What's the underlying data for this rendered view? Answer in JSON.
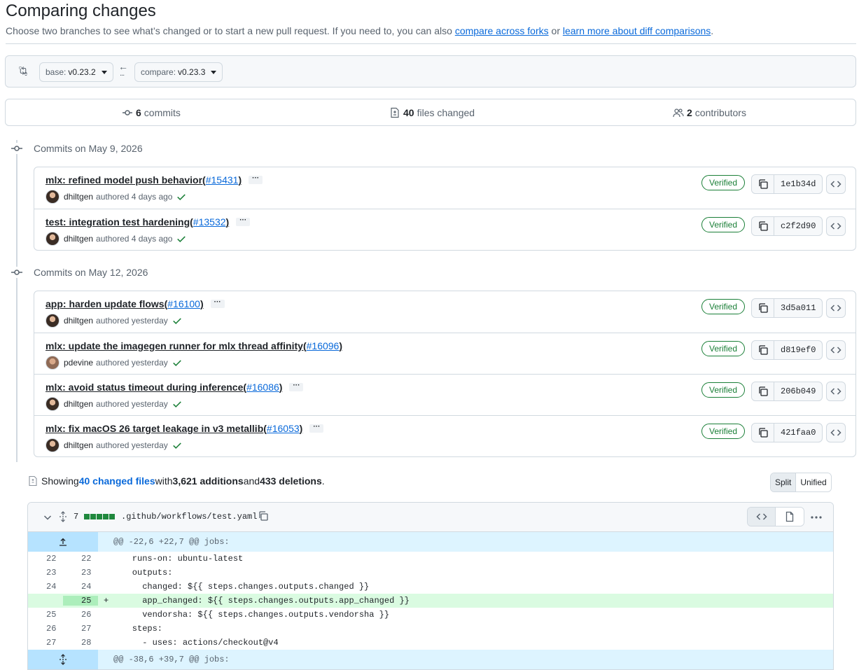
{
  "header": {
    "title": "Comparing changes",
    "desc_prefix": "Choose two branches to see what’s changed or to start a new pull request. If you need to, you can also ",
    "link_forks": "compare across forks",
    "desc_or": " or ",
    "link_learn": "learn more about diff comparisons",
    "desc_suffix": "."
  },
  "range": {
    "base_label": "base:",
    "base_value": "v0.23.2",
    "compare_label": "compare:",
    "compare_value": "v0.23.3"
  },
  "summary": {
    "commits_count": "6",
    "commits_label": "commits",
    "files_count": "40",
    "files_label": "files changed",
    "contributors_count": "2",
    "contributors_label": "contributors"
  },
  "commit_groups": [
    {
      "heading": "Commits on May 9, 2026",
      "commits": [
        {
          "msg": "mlx: refined model push behavior ",
          "pr": "#15431",
          "author": "dhiltgen",
          "when": "authored 4 days ago",
          "badge": "Verified",
          "sha": "1e1b34d"
        },
        {
          "msg": "test: integration test hardening ",
          "pr": "#13532",
          "author": "dhiltgen",
          "when": "authored 4 days ago",
          "badge": "Verified",
          "sha": "c2f2d90"
        }
      ]
    },
    {
      "heading": "Commits on May 12, 2026",
      "commits": [
        {
          "msg": "app: harden update flows ",
          "pr": "#16100",
          "author": "dhiltgen",
          "when": "authored yesterday",
          "badge": "Verified",
          "sha": "3d5a011"
        },
        {
          "msg": "mlx: update the imagegen runner for mlx thread affinity ",
          "pr": "#16096",
          "author": "pdevine",
          "when": "authored yesterday",
          "badge": "Verified",
          "sha": "d819ef0"
        },
        {
          "msg": "mlx: avoid status timeout during inference ",
          "pr": "#16086",
          "author": "dhiltgen",
          "when": "authored yesterday",
          "badge": "Verified",
          "sha": "206b049"
        },
        {
          "msg": "mlx: fix macOS 26 target leakage in v3 metallib ",
          "pr": "#16053",
          "author": "dhiltgen",
          "when": "authored yesterday",
          "badge": "Verified",
          "sha": "421faa0"
        }
      ]
    }
  ],
  "files_summary": {
    "showing": "Showing ",
    "changed_link": "40 changed files",
    "with": " with ",
    "additions": "3,621 additions",
    "and": " and ",
    "deletions": "433 deletions",
    "period": "."
  },
  "view_toggle": {
    "split": "Split",
    "unified": "Unified"
  },
  "diff": {
    "count": "7",
    "filename": ".github/workflows/test.yaml",
    "hunk1": "@@ -22,6 +22,7 @@ jobs:",
    "hunk2": "@@ -38,6 +39,7 @@ jobs:",
    "lines": [
      {
        "old": "22",
        "new": "22",
        "sign": "",
        "code": "    runs-on: ubuntu-latest"
      },
      {
        "old": "23",
        "new": "23",
        "sign": "",
        "code": "    outputs:"
      },
      {
        "old": "24",
        "new": "24",
        "sign": "",
        "code": "      changed: ${{ steps.changes.outputs.changed }}"
      },
      {
        "old": "",
        "new": "25",
        "sign": "+",
        "code": "      app_changed: ${{ steps.changes.outputs.app_changed }}"
      },
      {
        "old": "25",
        "new": "26",
        "sign": "",
        "code": "      vendorsha: ${{ steps.changes.outputs.vendorsha }}"
      },
      {
        "old": "26",
        "new": "27",
        "sign": "",
        "code": "    steps:"
      },
      {
        "old": "27",
        "new": "28",
        "sign": "",
        "code": "      - uses: actions/checkout@v4"
      }
    ]
  },
  "colors": {
    "link": "#0969da",
    "verified": "#1a7f37",
    "add_bg": "#dafbe1",
    "hunk_bg": "#ddf4ff"
  }
}
